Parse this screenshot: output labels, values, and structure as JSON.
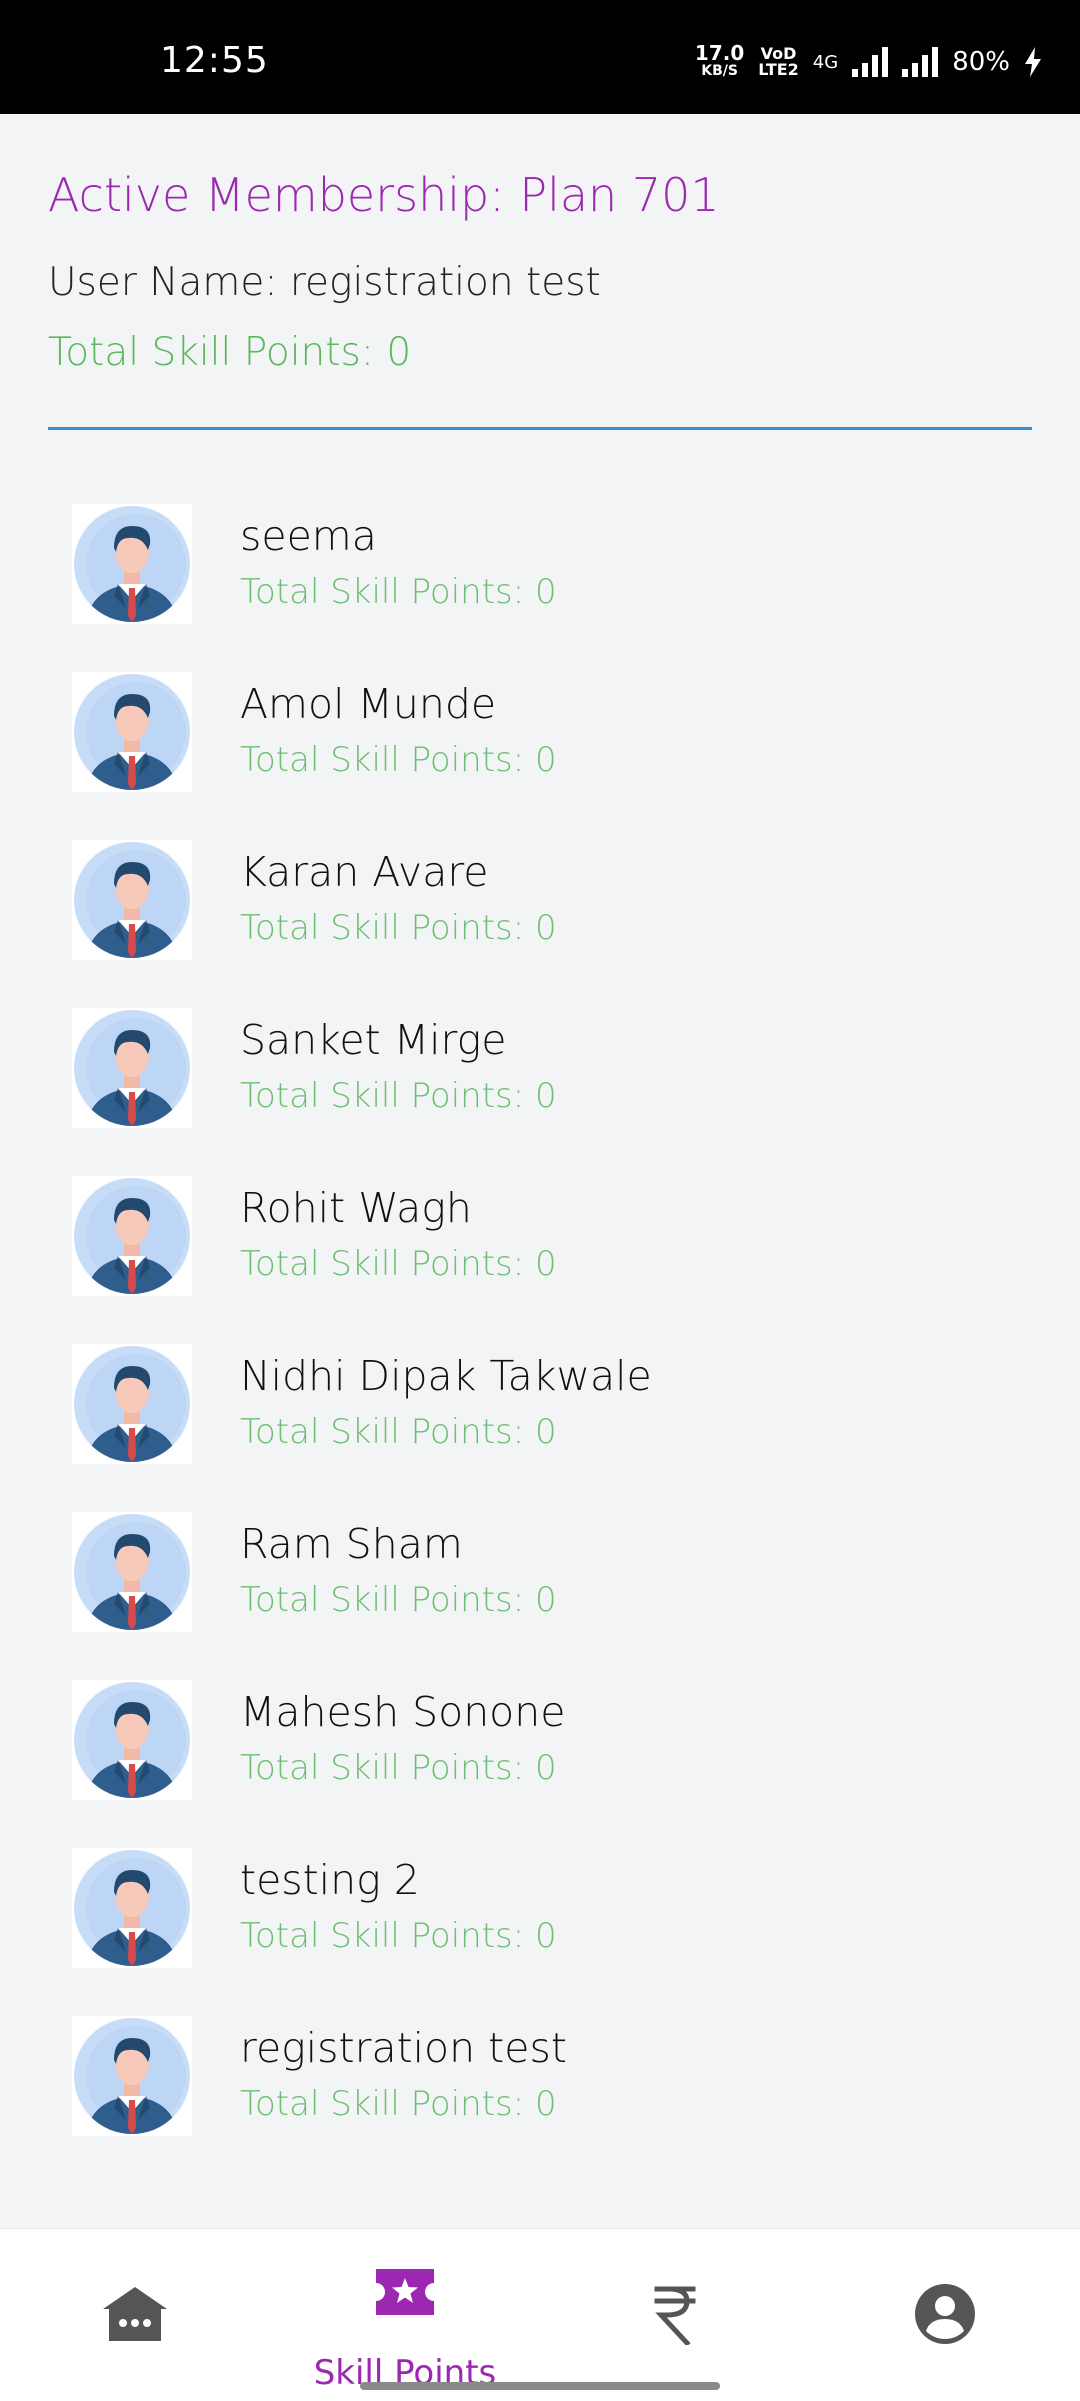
{
  "status_bar": {
    "time": "12:55",
    "net_speed": "17.0",
    "net_unit": "KB/S",
    "volte_top": "VoD",
    "volte_bottom": "LTE2",
    "net_type": "4G",
    "battery": "80%"
  },
  "header": {
    "membership": "Active Membership: Plan 701",
    "user_name": "User Name: registration test",
    "total_points": "Total Skill Points: 0"
  },
  "members": [
    {
      "name": "seema",
      "points": "Total Skill Points: 0"
    },
    {
      "name": "Amol Munde",
      "points": "Total Skill Points: 0"
    },
    {
      "name": "Karan Avare",
      "points": "Total Skill Points: 0"
    },
    {
      "name": "Sanket Mirge",
      "points": "Total Skill Points: 0"
    },
    {
      "name": "Rohit Wagh",
      "points": "Total Skill Points: 0"
    },
    {
      "name": "Nidhi Dipak Takwale",
      "points": "Total Skill Points: 0"
    },
    {
      "name": "Ram Sham",
      "points": "Total Skill Points: 0"
    },
    {
      "name": "Mahesh Sonone",
      "points": "Total Skill Points: 0"
    },
    {
      "name": "testing 2",
      "points": "Total Skill Points: 0"
    },
    {
      "name": "registration test",
      "points": "Total Skill Points: 0"
    }
  ],
  "bottom_nav": {
    "items": [
      {
        "icon": "home-icon"
      },
      {
        "icon": "star-ticket-icon",
        "label": "Skill Points",
        "active": true
      },
      {
        "icon": "rupee-icon"
      },
      {
        "icon": "account-circle-icon"
      }
    ]
  },
  "colors": {
    "accent": "#9c27b0",
    "points_green": "#5cb85c",
    "divider_blue": "#2f8fd8",
    "inactive_icon": "#555555"
  }
}
